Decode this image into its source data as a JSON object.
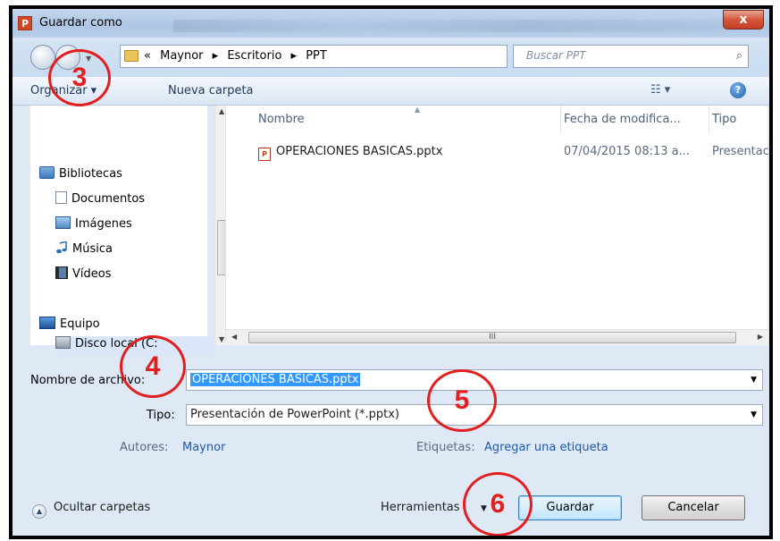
{
  "window": {
    "title": "Guardar como",
    "app_icon": "P",
    "close_label": "x"
  },
  "address_bar": {
    "breadcrumbs": [
      "«",
      "Maynor",
      "▸",
      "Escritorio",
      "▸",
      "PPT"
    ],
    "search_placeholder": "Buscar PPT"
  },
  "toolbar": {
    "organize_label": "Organizar ▾",
    "new_folder_label": "Nueva carpeta",
    "help_label": "?"
  },
  "sidebar": {
    "items": [
      {
        "label": "Bibliotecas",
        "icon": "library-icon"
      },
      {
        "label": "Documentos",
        "icon": "documents-icon"
      },
      {
        "label": "Imágenes",
        "icon": "pictures-icon"
      },
      {
        "label": "Música",
        "icon": "music-icon"
      },
      {
        "label": "Vídeos",
        "icon": "videos-icon"
      },
      {
        "label": "Equipo",
        "icon": "computer-icon"
      },
      {
        "label": "Disco local (C:",
        "icon": "disk-icon"
      }
    ]
  },
  "file_list": {
    "columns": [
      "Nombre",
      "Fecha de modifica...",
      "Tipo"
    ],
    "rows": [
      {
        "name": "OPERACIONES BASICAS.pptx",
        "date": "07/04/2015 08:13 a...",
        "type": "Presentac"
      }
    ],
    "hscroll_grip": "III"
  },
  "form": {
    "filename_label": "Nombre de archivo:",
    "filename_value": "OPERACIONES BASICAS.pptx",
    "type_label": "Tipo:",
    "type_value": "Presentación de PowerPoint (*.pptx)",
    "authors_label": "Autores:",
    "authors_value": "Maynor",
    "tags_label": "Etiquetas:",
    "tags_value": "Agregar una etiqueta"
  },
  "footer": {
    "hide_folders_label": "Ocultar carpetas",
    "tools_label": "Herramientas",
    "save_label": "Guardar",
    "cancel_label": "Cancelar"
  },
  "annotations": [
    "3",
    "4",
    "5",
    "6"
  ],
  "colors": {
    "annotation": "#e31e1e",
    "selection": "#3399ff",
    "link": "#1e5aa8"
  }
}
